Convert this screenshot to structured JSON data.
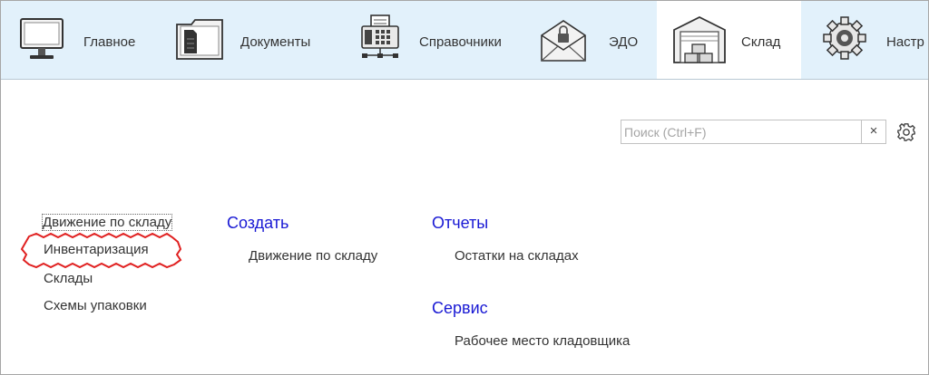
{
  "toolbar": {
    "tabs": [
      {
        "label": "Главное",
        "icon": "monitor-icon"
      },
      {
        "label": "Документы",
        "icon": "folder-document-icon"
      },
      {
        "label": "Справочники",
        "icon": "fax-network-icon"
      },
      {
        "label": "ЭДО",
        "icon": "secure-mail-icon"
      },
      {
        "label": "Склад",
        "icon": "warehouse-icon",
        "active": true
      },
      {
        "label": "Настр",
        "icon": "settings-gear-icon"
      }
    ]
  },
  "search": {
    "placeholder": "Поиск (Ctrl+F)",
    "clear_label": "×"
  },
  "nav": {
    "items": [
      {
        "label": "Движение по складу",
        "focused": true
      },
      {
        "label": "Инвентаризация",
        "highlighted": true
      },
      {
        "label": "Склады"
      },
      {
        "label": "Схемы упаковки"
      }
    ]
  },
  "sections": {
    "create": {
      "title": "Создать",
      "links": [
        "Движение по складу"
      ]
    },
    "reports": {
      "title": "Отчеты",
      "links": [
        "Остатки на складах"
      ]
    },
    "service": {
      "title": "Сервис",
      "links": [
        "Рабочее место кладовщика"
      ]
    }
  },
  "colors": {
    "toolbar_bg": "#e2f1fb",
    "section_heading": "#1919d4",
    "highlight_marker": "#e02020"
  }
}
